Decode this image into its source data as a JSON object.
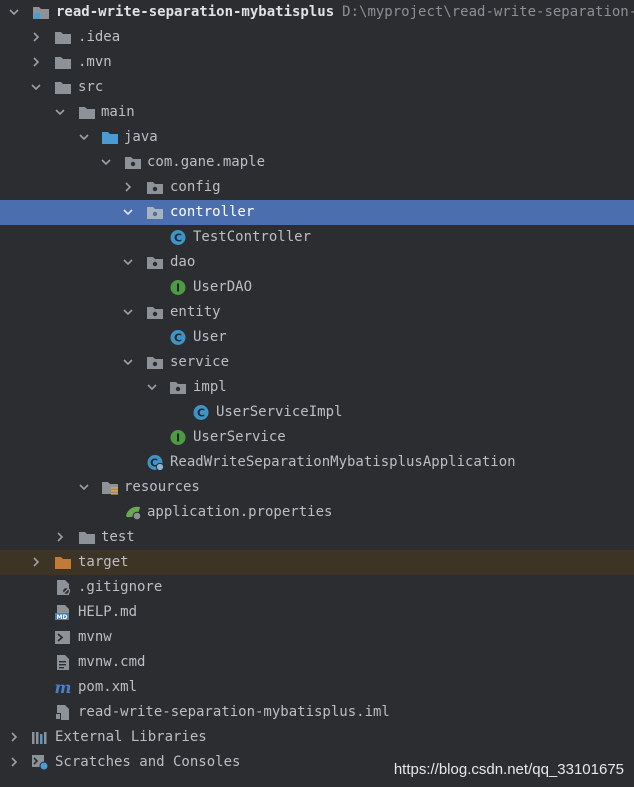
{
  "tree": {
    "root": {
      "label": "read-write-separation-mybatisplus",
      "path": "D:\\myproject\\read-write-separation-myb"
    },
    "idea": "idea",
    "idea_prefix": ".",
    "mvn": ".mvn",
    "src": "src",
    "main": "main",
    "java": "java",
    "package": "com.gane.maple",
    "config": "config",
    "controller": "controller",
    "test_controller": "TestController",
    "dao": "dao",
    "user_dao": "UserDAO",
    "entity": "entity",
    "user": "User",
    "service": "service",
    "impl": "impl",
    "user_service_impl": "UserServiceImpl",
    "user_service": "UserService",
    "application": "ReadWriteSeparationMybatisplusApplication",
    "resources": "resources",
    "application_properties": "application.properties",
    "test": "test",
    "target": "target",
    "gitignore": ".gitignore",
    "help": "HELP.md",
    "mvnw": "mvnw",
    "mvnw_cmd": "mvnw.cmd",
    "pom": "pom.xml",
    "iml": "read-write-separation-mybatisplus.iml",
    "external_libraries": "External Libraries",
    "scratches": "Scratches and Consoles"
  },
  "selected_item": "controller",
  "colors": {
    "background": "#2b2d30",
    "selection": "#4b6eaf",
    "folder": "#8c9298",
    "source_folder": "#4a9ad4",
    "excluded_folder": "#c07a3a",
    "class_icon": "#3f94c7",
    "interface_icon": "#4f9a45"
  },
  "watermark": "https://blog.csdn.net/qq_33101675"
}
